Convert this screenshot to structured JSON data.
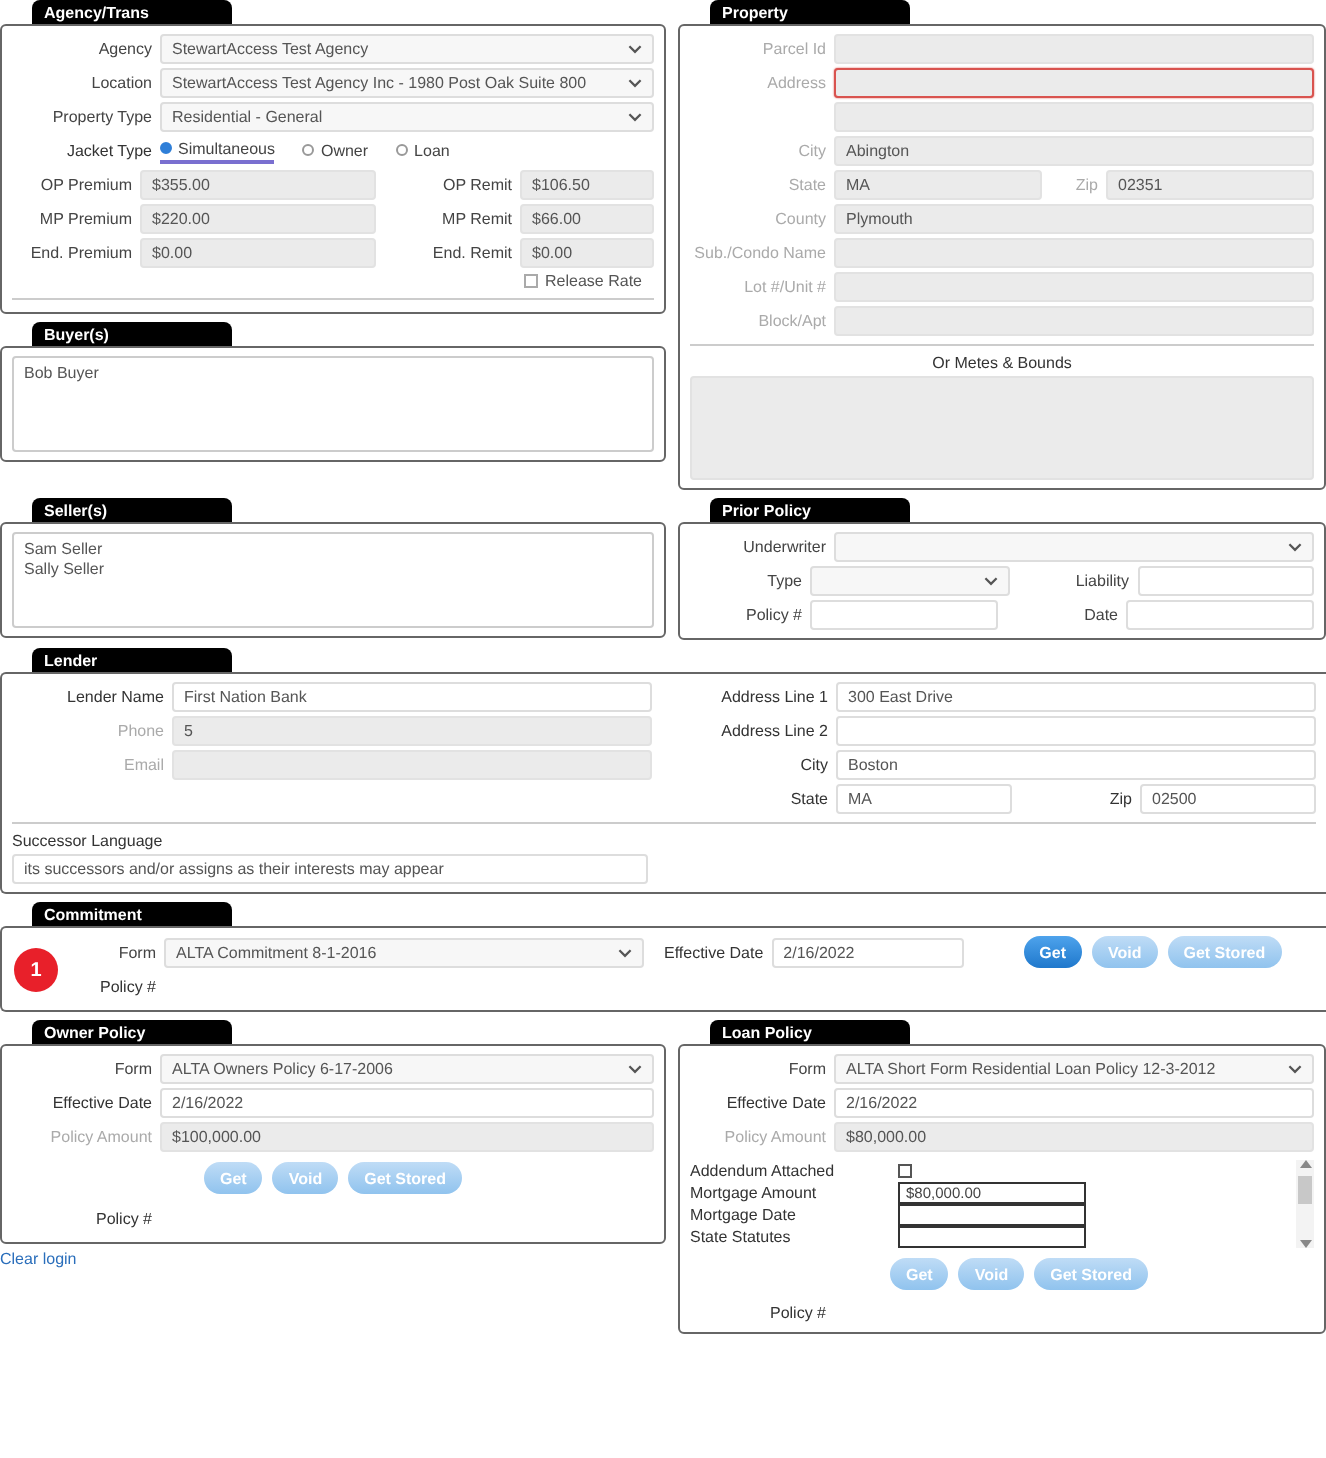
{
  "agency": {
    "title": "Agency/Trans",
    "selects": [
      {
        "label": "Agency",
        "value": "StewartAccess Test Agency"
      },
      {
        "label": "Location",
        "value": "StewartAccess Test Agency Inc - 1980 Post Oak Suite 800"
      },
      {
        "label": "Property Type",
        "value": "Residential - General"
      }
    ],
    "jacket_type": {
      "label": "Jacket Type",
      "options": [
        {
          "label": "Simultaneous",
          "selected": true
        },
        {
          "label": "Owner",
          "selected": false
        },
        {
          "label": "Loan",
          "selected": false
        }
      ]
    },
    "amounts": [
      {
        "label": "OP Premium",
        "value": "$355.00"
      },
      {
        "label": "OP Remit",
        "value": "$106.50"
      },
      {
        "label": "MP Premium",
        "value": "$220.00"
      },
      {
        "label": "MP Remit",
        "value": "$66.00"
      },
      {
        "label": "End. Premium",
        "value": "$0.00"
      },
      {
        "label": "End. Remit",
        "value": "$0.00"
      }
    ],
    "release_rate": {
      "label": "Release Rate",
      "checked": false
    }
  },
  "buyers": {
    "title": "Buyer(s)",
    "lines": [
      "Bob Buyer"
    ]
  },
  "property": {
    "title": "Property",
    "fields": [
      {
        "label": "Parcel Id",
        "invalid": false
      },
      {
        "label": "Address",
        "invalid": true
      },
      {
        "invalid": false
      },
      {
        "label": "City",
        "value": "Abington",
        "invalid": false
      },
      {
        "label": "State",
        "value": "MA",
        "invalid": false,
        "side": {
          "label": "Zip",
          "value": "02351"
        }
      },
      {
        "label": "County",
        "value": "Plymouth",
        "invalid": false
      },
      {
        "label": "Sub./Condo Name",
        "invalid": false
      },
      {
        "label": "Lot #/Unit #",
        "invalid": false
      },
      {
        "label": "Block/Apt",
        "invalid": false
      }
    ],
    "metes_label": "Or Metes & Bounds"
  },
  "sellers": {
    "title": "Seller(s)",
    "lines": [
      "Sam Seller",
      "Sally Seller"
    ]
  },
  "prior_policy": {
    "title": "Prior Policy",
    "underwriter_label": "Underwriter",
    "type_label": "Type",
    "liability_label": "Liability",
    "policy_no_label": "Policy #",
    "date_label": "Date"
  },
  "lender": {
    "title": "Lender",
    "left": [
      {
        "label": "Lender Name",
        "value": "First Nation Bank",
        "disabled": false
      },
      {
        "label": "Phone",
        "value": "5",
        "disabled": true
      },
      {
        "label": "Email",
        "disabled": true
      }
    ],
    "right": [
      {
        "label": "Address Line 1",
        "value": "300 East Drive"
      },
      {
        "label": "Address Line 2"
      },
      {
        "label": "City",
        "value": "Boston"
      }
    ],
    "state": {
      "label": "State",
      "value": "MA"
    },
    "zip": {
      "label": "Zip",
      "value": "02500"
    },
    "successor": {
      "label": "Successor Language",
      "value": "its successors and/or assigns as their interests may appear"
    }
  },
  "commitment": {
    "title": "Commitment",
    "badge": "1",
    "form": {
      "label": "Form",
      "value": "ALTA Commitment 8-1-2016"
    },
    "effective_date": {
      "label": "Effective Date",
      "value": "2/16/2022"
    },
    "buttons": [
      {
        "label": "Get",
        "disabled": false
      },
      {
        "label": "Void",
        "disabled": true
      },
      {
        "label": "Get Stored",
        "disabled": true
      }
    ],
    "policy_no_label": "Policy #"
  },
  "owner_policy": {
    "title": "Owner Policy",
    "form": {
      "label": "Form",
      "value": "ALTA Owners Policy 6-17-2006"
    },
    "effective_date": {
      "label": "Effective Date",
      "value": "2/16/2022"
    },
    "policy_amount": {
      "label": "Policy Amount",
      "value": "$100,000.00"
    },
    "buttons": [
      {
        "label": "Get",
        "disabled": true
      },
      {
        "label": "Void",
        "disabled": true
      },
      {
        "label": "Get Stored",
        "disabled": true
      }
    ],
    "policy_no_label": "Policy #"
  },
  "clear_login": "Clear login",
  "loan_policy": {
    "title": "Loan Policy",
    "form": {
      "label": "Form",
      "value": "ALTA Short Form Residential Loan Policy 12-3-2012"
    },
    "effective_date": {
      "label": "Effective Date",
      "value": "2/16/2022"
    },
    "policy_amount": {
      "label": "Policy Amount",
      "value": "$80,000.00"
    },
    "extras": [
      {
        "kind": "checkbox",
        "label": "Addendum Attached",
        "checked": false
      },
      {
        "kind": "text",
        "label": "Mortgage Amount",
        "value": "$80,000.00"
      },
      {
        "kind": "text",
        "label": "Mortgage Date"
      },
      {
        "kind": "text",
        "label": "State Statutes"
      }
    ],
    "buttons": [
      {
        "label": "Get",
        "disabled": true
      },
      {
        "label": "Void",
        "disabled": true
      },
      {
        "label": "Get Stored",
        "disabled": true
      }
    ],
    "policy_no_label": "Policy #"
  }
}
